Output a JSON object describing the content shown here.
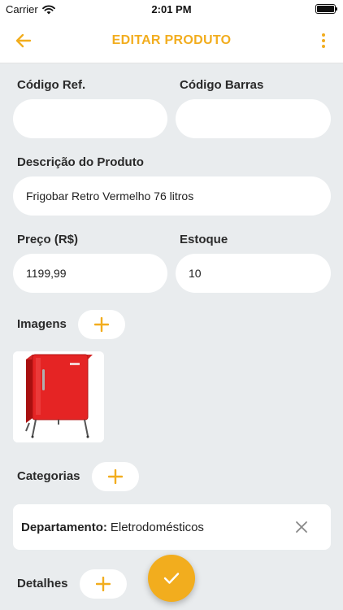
{
  "status_bar": {
    "carrier": "Carrier",
    "time": "2:01 PM",
    "wifi_icon": "wifi-icon",
    "battery_level": 1.0
  },
  "nav": {
    "title": "EDITAR PRODUTO",
    "back_icon": "arrow-left-icon",
    "menu_icon": "more-vertical-icon"
  },
  "form": {
    "codigo_ref": {
      "label": "Código Ref.",
      "value": ""
    },
    "codigo_barras": {
      "label": "Código Barras",
      "value": ""
    },
    "descricao": {
      "label": "Descrição do Produto",
      "value": "Frigobar Retro Vermelho 76 litros"
    },
    "preco": {
      "label": "Preço (R$)",
      "value": "1199,99"
    },
    "estoque": {
      "label": "Estoque",
      "value": "10"
    }
  },
  "images": {
    "label": "Imagens",
    "add_icon": "plus-icon",
    "items": [
      {
        "alt": "red retro mini fridge"
      }
    ]
  },
  "categories": {
    "label": "Categorias",
    "add_icon": "plus-icon",
    "items": [
      {
        "key": "Departamento:",
        "value": "Eletrodomésticos"
      }
    ]
  },
  "details": {
    "label": "Detalhes",
    "add_icon": "plus-icon"
  },
  "fab": {
    "icon": "check-icon"
  },
  "colors": {
    "accent": "#f2ad1e",
    "background": "#e9ecee",
    "surface": "#ffffff"
  }
}
